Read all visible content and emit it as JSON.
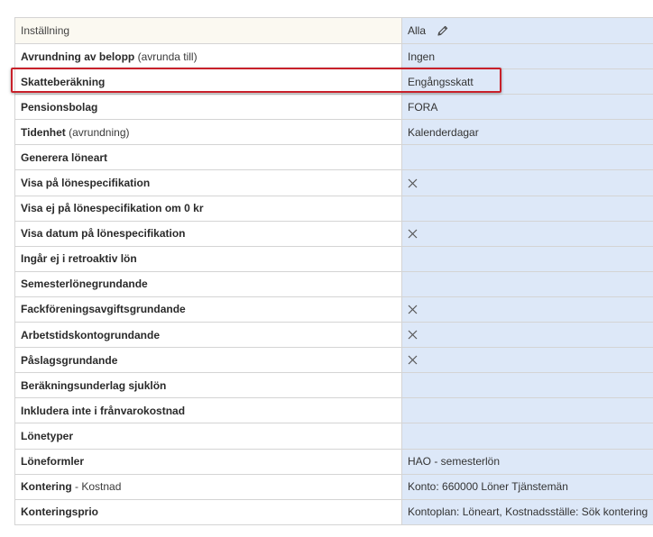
{
  "header": {
    "setting_label": "Inställning",
    "value_label": "Alla"
  },
  "rows": [
    {
      "name": "Avrundning av belopp",
      "suffix": " (avrunda till)",
      "value": "Ingen"
    },
    {
      "name": "Skatteberäkning",
      "suffix": "",
      "value": "Engångsskatt"
    },
    {
      "name": "Pensionsbolag",
      "suffix": "",
      "value": "FORA"
    },
    {
      "name": "Tidenhet",
      "suffix": " (avrundning)",
      "value": "Kalenderdagar"
    },
    {
      "name": "Generera löneart",
      "suffix": "",
      "value": ""
    },
    {
      "name": "Visa på lönespecifikation",
      "suffix": "",
      "value": "",
      "checked": true
    },
    {
      "name": "Visa ej på lönespecifikation om 0 kr",
      "suffix": "",
      "value": ""
    },
    {
      "name": "Visa datum på lönespecifikation",
      "suffix": "",
      "value": "",
      "checked": true
    },
    {
      "name": "Ingår ej i retroaktiv lön",
      "suffix": "",
      "value": ""
    },
    {
      "name": "Semesterlönegrundande",
      "suffix": "",
      "value": ""
    },
    {
      "name": "Fackföreningsavgiftsgrundande",
      "suffix": "",
      "value": "",
      "checked": true
    },
    {
      "name": "Arbetstidskontogrundande",
      "suffix": "",
      "value": "",
      "checked": true
    },
    {
      "name": "Påslagsgrundande",
      "suffix": "",
      "value": "",
      "checked": true
    },
    {
      "name": "Beräkningsunderlag sjuklön",
      "suffix": "",
      "value": ""
    },
    {
      "name": "Inkludera inte i frånvarokostnad",
      "suffix": "",
      "value": ""
    },
    {
      "name": "Lönetyper",
      "suffix": "",
      "value": ""
    },
    {
      "name": "Löneformler",
      "suffix": "",
      "value": "HAO - semesterlön"
    },
    {
      "name": "Kontering",
      "suffix": " - Kostnad",
      "value": "Konto: 660000 Löner Tjänstemän"
    },
    {
      "name": "Konteringsprio",
      "suffix": "",
      "value": "Kontoplan: Löneart, Kostnadsställe: Sök kontering"
    }
  ],
  "icons": {
    "edit": "pencil-icon",
    "checked": "x-mark-icon"
  },
  "colors": {
    "value_column_bg": "#dde8f8",
    "highlight_border": "#c8202a"
  }
}
